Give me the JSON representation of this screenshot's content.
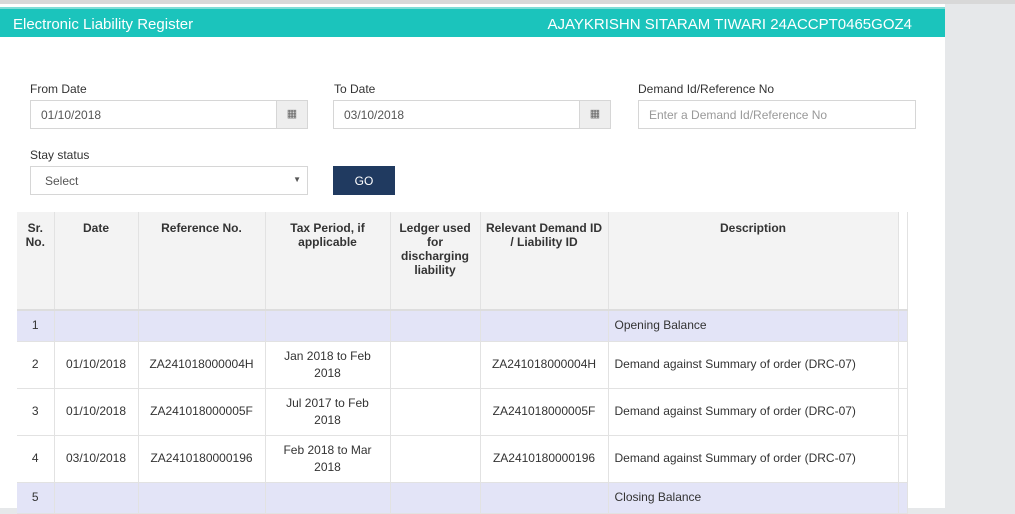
{
  "header": {
    "title": "Electronic Liability Register",
    "user": "AJAYKRISHN SITARAM TIWARI 24ACCPT0465GOZ4"
  },
  "form": {
    "from_date": {
      "label": "From Date",
      "value": "01/10/2018"
    },
    "to_date": {
      "label": "To Date",
      "value": "03/10/2018"
    },
    "demand_id": {
      "label": "Demand Id/Reference No",
      "placeholder": "Enter a Demand Id/Reference No"
    },
    "stay_status": {
      "label": "Stay status",
      "value": "Select"
    },
    "go_label": "GO"
  },
  "table": {
    "headers": [
      "Sr. No.",
      "Date",
      "Reference No.",
      "Tax Period, if applicable",
      "Ledger used for discharging liability",
      "Relevant Demand ID / Liability ID",
      "Description"
    ],
    "rows": [
      {
        "sr": "1",
        "date": "",
        "ref": "",
        "period": "",
        "ledger": "",
        "demand": "",
        "desc": "Opening Balance",
        "balance": true
      },
      {
        "sr": "2",
        "date": "01/10/2018",
        "ref": "ZA241018000004H",
        "period": "Jan 2018 to Feb 2018",
        "ledger": "",
        "demand": "ZA241018000004H",
        "desc": "Demand against Summary of order (DRC-07)"
      },
      {
        "sr": "3",
        "date": "01/10/2018",
        "ref": "ZA241018000005F",
        "period": "Jul 2017 to Feb 2018",
        "ledger": "",
        "demand": "ZA241018000005F",
        "desc": "Demand against Summary of order (DRC-07)"
      },
      {
        "sr": "4",
        "date": "03/10/2018",
        "ref": "ZA2410180000196",
        "period": "Feb 2018 to Mar 2018",
        "ledger": "",
        "demand": "ZA2410180000196",
        "desc": "Demand against Summary of order (DRC-07)"
      },
      {
        "sr": "5",
        "date": "",
        "ref": "",
        "period": "",
        "ledger": "",
        "demand": "",
        "desc": "Closing Balance",
        "balance": true
      }
    ]
  },
  "colors": {
    "header": "#1bc4bc",
    "go_button": "#203a60",
    "balance_row": "#e3e4f7"
  }
}
